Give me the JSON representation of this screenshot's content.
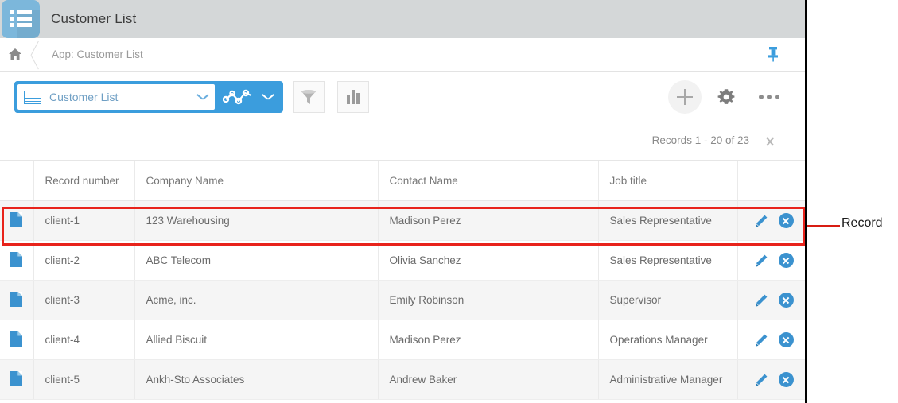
{
  "window": {
    "app_icon_name": "list-app-icon",
    "title": "Customer List"
  },
  "breadcrumb": {
    "home_icon": "home-icon",
    "path": "App: Customer List",
    "pin_icon": "pin-icon"
  },
  "toolbar": {
    "view_selector": {
      "grid_icon": "table-grid-icon",
      "label": "Customer List",
      "chevron_icon": "chevron-down-icon"
    },
    "graph_button": {
      "icon": "line-graph-icon",
      "chevron_icon": "chevron-down-icon"
    },
    "filter_button_icon": "filter-funnel-icon",
    "chart_button_icon": "bar-chart-icon",
    "add_button_icon": "plus-icon",
    "settings_button_icon": "gear-icon",
    "more_button_icon": "ellipsis-icon"
  },
  "pagination": {
    "label": "Records 1 - 20 of 23",
    "next_icon": "chevron-right-icon"
  },
  "table": {
    "headers": {
      "record_number": "Record number",
      "company_name": "Company Name",
      "contact_name": "Contact Name",
      "job_title": "Job title"
    },
    "rows": [
      {
        "record_icon": "file-document-icon",
        "record_number": "client-1",
        "company_name": "123 Warehousing",
        "contact_name": "Madison Perez",
        "job_title": "Sales Representative",
        "edit_icon": "pencil-edit-icon",
        "delete_icon": "circle-close-icon"
      },
      {
        "record_icon": "file-document-icon",
        "record_number": "client-2",
        "company_name": "ABC Telecom",
        "contact_name": "Olivia Sanchez",
        "job_title": "Sales Representative",
        "edit_icon": "pencil-edit-icon",
        "delete_icon": "circle-close-icon"
      },
      {
        "record_icon": "file-document-icon",
        "record_number": "client-3",
        "company_name": "Acme, inc.",
        "contact_name": "Emily Robinson",
        "job_title": "Supervisor",
        "edit_icon": "pencil-edit-icon",
        "delete_icon": "circle-close-icon"
      },
      {
        "record_icon": "file-document-icon",
        "record_number": "client-4",
        "company_name": "Allied Biscuit",
        "contact_name": "Madison Perez",
        "job_title": "Operations Manager",
        "edit_icon": "pencil-edit-icon",
        "delete_icon": "circle-close-icon"
      },
      {
        "record_icon": "file-document-icon",
        "record_number": "client-5",
        "company_name": "Ankh-Sto Associates",
        "contact_name": "Andrew Baker",
        "job_title": "Administrative Manager",
        "edit_icon": "pencil-edit-icon",
        "delete_icon": "circle-close-icon"
      }
    ]
  },
  "annotation": {
    "label": "Record",
    "color": "#e8231b"
  },
  "colors": {
    "titlebar_bg": "#d4d7d8",
    "app_icon": "#7cb7db",
    "accent_blue": "#3b9ddd",
    "row_alt": "#f5f5f5",
    "annotation_red": "#e8231b"
  }
}
